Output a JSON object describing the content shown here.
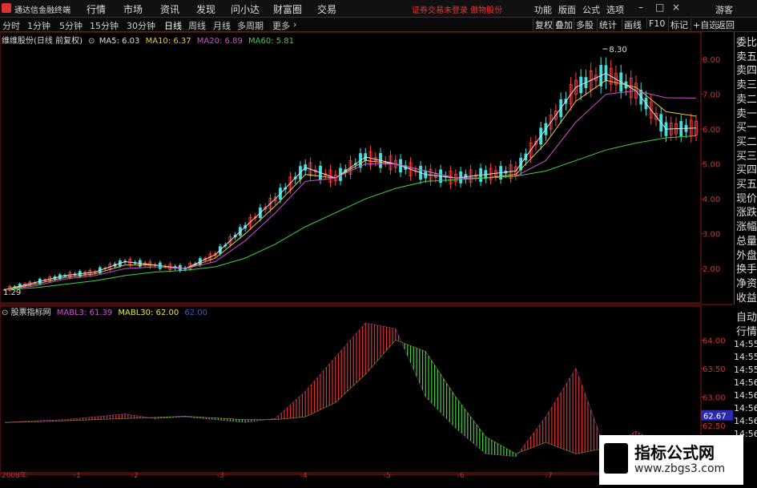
{
  "app": {
    "title": "通达信金融终端"
  },
  "menu": [
    "行情",
    "市场",
    "资讯",
    "发现",
    "问小达",
    "财富圈",
    "交易"
  ],
  "notice": "证券交易未登录 傲物股份",
  "right_menu": [
    "功能",
    "版面",
    "公式",
    "选项"
  ],
  "guest": "游客",
  "periods": [
    "分时",
    "1分钟",
    "5分钟",
    "15分钟",
    "30分钟",
    "日线",
    "周线",
    "月线",
    "多周期",
    "更多"
  ],
  "active_period": "日线",
  "right_tools": [
    "复权",
    "叠加",
    "多股",
    "统计",
    "画线",
    "F10",
    "标记",
    "+自选",
    "返回"
  ],
  "main_legend": {
    "stock": "维维股份(日线 前复权)",
    "items": [
      {
        "label": "MA5: 6.03",
        "color": "#dddddd"
      },
      {
        "label": "MA10: 6.37",
        "color": "#e6c84a"
      },
      {
        "label": "MA20: 6.89",
        "color": "#d050d0"
      },
      {
        "label": "MA60: 5.81",
        "color": "#40d040"
      }
    ]
  },
  "price_axis": [
    "8.00",
    "7.00",
    "6.00",
    "5.00",
    "4.00",
    "3.00",
    "2.00"
  ],
  "high_label": "8.30",
  "low_label": "1.29",
  "ind_legend": {
    "name": "股票指标网",
    "items": [
      {
        "label": "MABL3: 61.39",
        "color": "#d050d0"
      },
      {
        "label": "MABL30: 62.00",
        "color": "#e6e64a"
      },
      {
        "label": "62.00",
        "color": "#3b5ccc"
      }
    ]
  },
  "ind_axis": [
    "64.00",
    "63.50",
    "63.00",
    "62.50",
    "62.00"
  ],
  "ind_marker": "62.67",
  "date_axis": [
    "2008年",
    "1",
    "2",
    "3",
    "4",
    "5",
    "6",
    "7"
  ],
  "sidebar": [
    "委比",
    "卖五",
    "卖四",
    "卖三",
    "卖二",
    "卖一",
    "买一",
    "买二",
    "买三",
    "买四",
    "买五",
    "现价",
    "涨跌",
    "涨幅",
    "总量",
    "外盘",
    "换手",
    "净资",
    "收益"
  ],
  "sidebar2": [
    "自动",
    "行情"
  ],
  "time_col": [
    "14:55",
    "14:55",
    "14:55",
    "14:56",
    "14:56",
    "14:56",
    "14:56",
    "14:56"
  ],
  "watermark": {
    "title": "指标公式网",
    "url": "www.zbgs3.com"
  },
  "chart_data": [
    {
      "type": "line",
      "title": "维维股份(日线 前复权)",
      "xlabel": "",
      "ylabel": "",
      "ylim": [
        1.2,
        8.6
      ],
      "series": [
        {
          "name": "MA5",
          "values": [
            1.4,
            1.6,
            1.8,
            1.9,
            2.2,
            2.1,
            2.0,
            2.4,
            3.2,
            4.0,
            4.9,
            4.6,
            5.2,
            5.0,
            4.7,
            4.6,
            4.7,
            4.8,
            6.0,
            7.2,
            7.6,
            7.1,
            6.0,
            6.03
          ]
        },
        {
          "name": "MA10",
          "values": [
            1.4,
            1.55,
            1.75,
            1.85,
            2.1,
            2.1,
            2.0,
            2.3,
            3.0,
            3.8,
            4.7,
            4.6,
            5.1,
            5.0,
            4.8,
            4.6,
            4.6,
            4.7,
            5.6,
            6.8,
            7.4,
            7.2,
            6.5,
            6.37
          ]
        },
        {
          "name": "MA20",
          "values": [
            1.4,
            1.5,
            1.7,
            1.8,
            2.0,
            2.05,
            2.0,
            2.2,
            2.8,
            3.6,
            4.5,
            4.6,
            5.0,
            5.0,
            4.8,
            4.6,
            4.6,
            4.65,
            5.1,
            6.2,
            7.0,
            7.1,
            6.9,
            6.89
          ]
        },
        {
          "name": "MA60",
          "values": [
            1.4,
            1.45,
            1.55,
            1.65,
            1.8,
            1.9,
            1.95,
            2.05,
            2.3,
            2.7,
            3.2,
            3.6,
            4.0,
            4.3,
            4.5,
            4.55,
            4.6,
            4.65,
            4.8,
            5.1,
            5.4,
            5.6,
            5.75,
            5.81
          ]
        }
      ]
    },
    {
      "type": "bar",
      "title": "股票指标网",
      "xlabel": "",
      "ylabel": "",
      "ylim": [
        61.75,
        64.4
      ],
      "series": [
        {
          "name": "MABL3",
          "values": [
            62.55,
            62.58,
            62.6,
            62.65,
            62.7,
            62.62,
            62.65,
            62.6,
            62.55,
            62.62,
            63.1,
            63.7,
            64.3,
            64.2,
            63.0,
            62.45,
            62.0,
            61.95,
            62.65,
            63.5,
            62.05,
            62.4,
            62.1,
            61.39
          ]
        },
        {
          "name": "MABL30",
          "values": [
            62.55,
            62.56,
            62.58,
            62.6,
            62.62,
            62.64,
            62.66,
            62.63,
            62.6,
            62.6,
            62.65,
            62.9,
            63.4,
            64.0,
            63.8,
            63.0,
            62.3,
            62.0,
            62.2,
            62.0,
            62.1,
            62.0,
            62.15,
            62.0
          ]
        }
      ]
    }
  ]
}
